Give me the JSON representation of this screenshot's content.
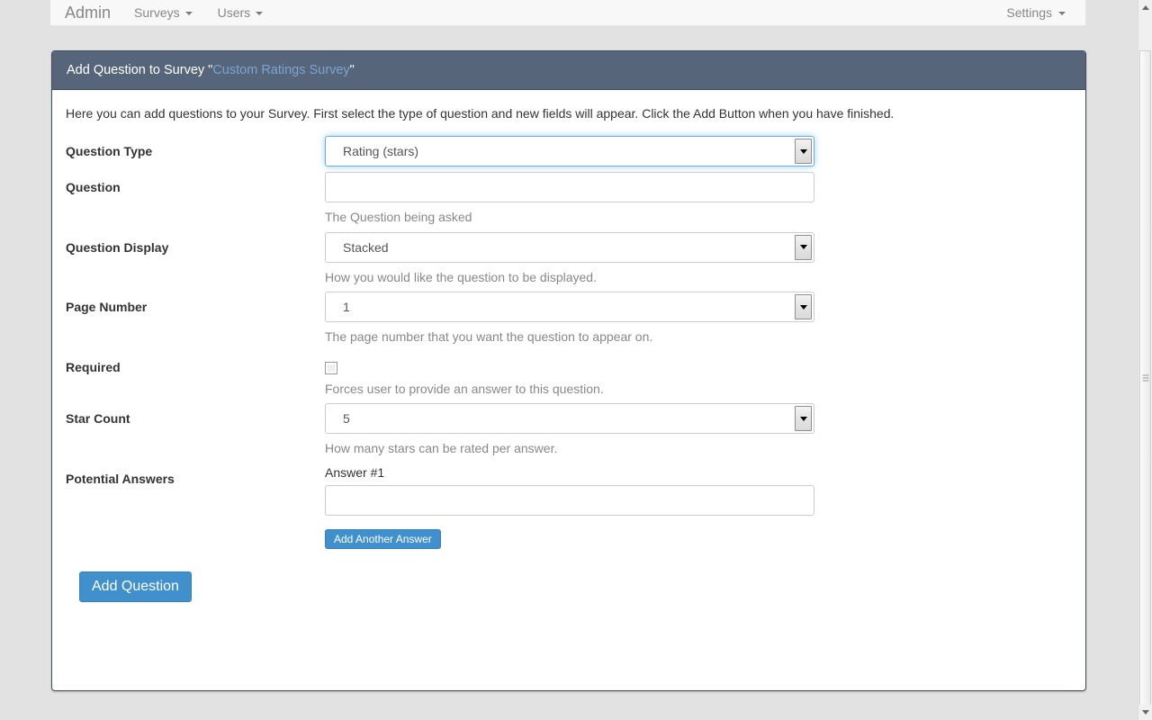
{
  "navbar": {
    "brand": "Admin",
    "items": [
      {
        "label": "Surveys",
        "caret": true,
        "icon": "chevron-down-icon"
      },
      {
        "label": "Users",
        "caret": true,
        "icon": "chevron-down-icon"
      }
    ],
    "right": {
      "label": "Settings",
      "caret": true,
      "icon": "chevron-down-icon"
    }
  },
  "panel": {
    "heading_prefix": "Add Question to Survey \"",
    "heading_link": "Custom Ratings Survey",
    "heading_suffix": "\"",
    "intro": "Here you can add questions to your Survey. First select the type of question and new fields will appear. Click the Add Button when you have finished.",
    "header_color": "#56657a",
    "link_color": "#7aa5d2"
  },
  "form": {
    "question_type": {
      "label": "Question Type",
      "value": "Rating (stars)",
      "focused": true,
      "options": [
        "Rating (stars)"
      ]
    },
    "question": {
      "label": "Question",
      "value": "",
      "placeholder": "",
      "help": "The Question being asked"
    },
    "question_display": {
      "label": "Question Display",
      "value": "Stacked",
      "help": "How you would like the question to be displayed.",
      "options": [
        "Stacked"
      ]
    },
    "page_number": {
      "label": "Page Number",
      "value": "1",
      "help": "The page number that you want the question to appear on.",
      "options": [
        "1"
      ]
    },
    "required": {
      "label": "Required",
      "checked": false,
      "help": "Forces user to provide an answer to this question."
    },
    "star_count": {
      "label": "Star Count",
      "value": "5",
      "help": "How many stars can be rated per answer.",
      "options": [
        "5"
      ]
    },
    "potential_answers": {
      "label": "Potential Answers",
      "answers": [
        {
          "label": "Answer #1",
          "value": "",
          "placeholder": ""
        }
      ],
      "add_another_label": "Add Another Answer"
    },
    "submit_label": "Add Question",
    "button_color": "#4190ce"
  }
}
